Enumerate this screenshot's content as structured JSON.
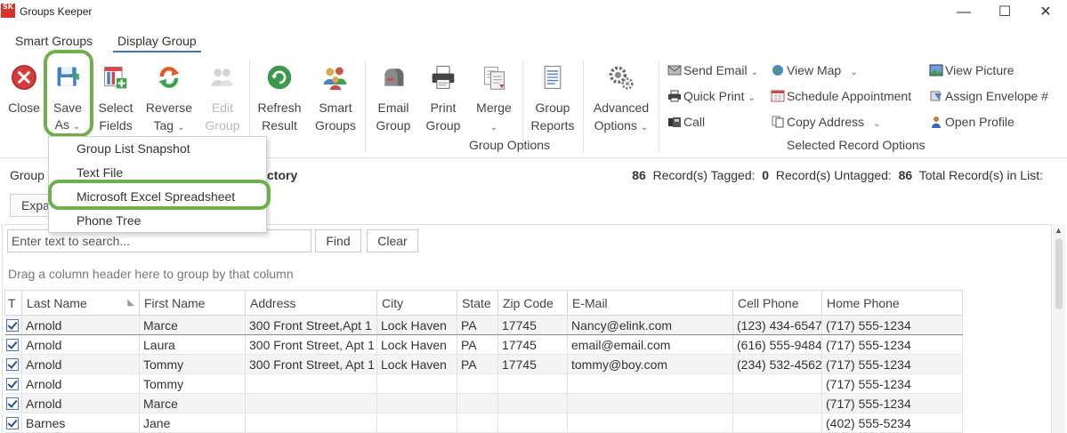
{
  "window": {
    "title": "Groups Keeper",
    "logo_text": "SK",
    "minimize": "—",
    "maximize": "☐",
    "close": "✕"
  },
  "tabs": [
    {
      "label": "Smart Groups"
    },
    {
      "label": "Display Group",
      "active": true
    }
  ],
  "ribbon": {
    "close": "Close",
    "save_as": [
      "Save",
      "As"
    ],
    "select_fields": [
      "Select",
      "Fields"
    ],
    "reverse_tag": [
      "Reverse",
      "Tag"
    ],
    "edit_group": [
      "Edit",
      "Group"
    ],
    "refresh_result": [
      "Refresh",
      "Result"
    ],
    "smart_groups": [
      "Smart",
      "Groups"
    ],
    "email_group": [
      "Email",
      "Group"
    ],
    "print_group": [
      "Print",
      "Group"
    ],
    "merge": "Merge",
    "group_reports": [
      "Group",
      "Reports"
    ],
    "advanced_options": [
      "Advanced",
      "Options"
    ],
    "group_options_label": "Group Options",
    "selected_record_options_label": "Selected Record Options",
    "send_email": "Send Email",
    "quick_print": "Quick Print",
    "call": "Call",
    "view_map": "View Map",
    "schedule_appointment": "Schedule Appointment",
    "copy_address": "Copy Address",
    "view_picture": "View Picture",
    "assign_envelope": "Assign Envelope #",
    "open_profile": "Open Profile"
  },
  "save_as_menu": {
    "items": [
      "Group List Snapshot",
      "Text File",
      "Microsoft Excel Spreadsheet",
      "Phone Tree"
    ]
  },
  "info": {
    "group_label": "Group",
    "group_name_fragment": "ctory",
    "tagged_count": "86",
    "tagged_label": "Record(s) Tagged:",
    "untagged_count": "0",
    "untagged_label": "Record(s) Untagged:",
    "total_count": "86",
    "total_label": "Total Record(s) in List:",
    "expand_label": "Expand"
  },
  "grid": {
    "search_placeholder": "Enter text to search...",
    "find": "Find",
    "clear": "Clear",
    "drag_hint": "Drag a column header here to group by that column",
    "columns": [
      "T",
      "Last Name",
      "First Name",
      "Address",
      "City",
      "State",
      "Zip Code",
      "E-Mail",
      "Cell Phone",
      "Home Phone"
    ],
    "rows": [
      {
        "last": "Arnold",
        "first": "Marce",
        "address": "300 Front Street,Apt 1",
        "city": "Lock Haven",
        "state": "PA",
        "zip": "17745",
        "email": "Nancy@elink.com",
        "cell": "(123) 434-6547",
        "home": "(717) 555-1234"
      },
      {
        "last": "Arnold",
        "first": "Laura",
        "address": "300 Front Street, Apt 1",
        "city": "Lock Haven",
        "state": "PA",
        "zip": "17745",
        "email": "email@email.com",
        "cell": "(616) 555-9484",
        "home": "(717) 555-1234"
      },
      {
        "last": "Arnold",
        "first": "Tommy",
        "address": "300 Front Street, Apt 1",
        "city": "Lock Haven",
        "state": "PA",
        "zip": "17745",
        "email": "tommy@boy.com",
        "cell": "(234) 532-4562",
        "home": "(717) 555-1234"
      },
      {
        "last": "Arnold",
        "first": "Tommy",
        "address": "",
        "city": "",
        "state": "",
        "zip": "",
        "email": "",
        "cell": "",
        "home": "(717) 555-1234"
      },
      {
        "last": "Arnold",
        "first": "Marce",
        "address": "",
        "city": "",
        "state": "",
        "zip": "",
        "email": "",
        "cell": "",
        "home": "(717) 555-1234"
      },
      {
        "last": "Barnes",
        "first": "Jane",
        "address": "",
        "city": "",
        "state": "",
        "zip": "",
        "email": "",
        "cell": "",
        "home": "(402) 555-5234"
      }
    ]
  },
  "colors": {
    "highlight": "#6fb04a",
    "tab_underline": "#3f73c6",
    "close_red": "#d63a3a"
  }
}
